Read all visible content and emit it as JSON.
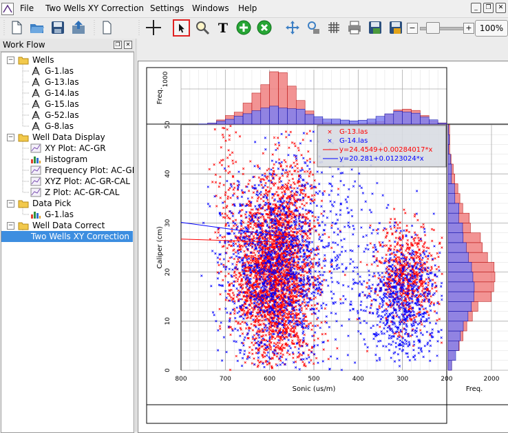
{
  "menubar": {
    "items": [
      "File",
      "Two Wells XY Correction",
      "Settings",
      "Windows",
      "Help"
    ]
  },
  "toolbar": {
    "zoom": "100%"
  },
  "workflow": {
    "title": "Work Flow",
    "tree": [
      {
        "label": "Wells",
        "icon": "folder-icon",
        "level": 0,
        "expander": "−"
      },
      {
        "label": "G-1.las",
        "icon": "well-icon",
        "level": 1
      },
      {
        "label": "G-13.las",
        "icon": "well-icon",
        "level": 1
      },
      {
        "label": "G-14.las",
        "icon": "well-icon",
        "level": 1
      },
      {
        "label": "G-15.las",
        "icon": "well-icon",
        "level": 1
      },
      {
        "label": "G-52.las",
        "icon": "well-icon",
        "level": 1
      },
      {
        "label": "G-8.las",
        "icon": "well-icon",
        "level": 1
      },
      {
        "label": "Well Data Display",
        "icon": "folder-icon",
        "level": 0,
        "expander": "−"
      },
      {
        "label": "XY Plot: AC-GR",
        "icon": "plot-icon",
        "level": 1
      },
      {
        "label": "Histogram",
        "icon": "histogram-icon",
        "level": 1
      },
      {
        "label": "Frequency Plot: AC-GR",
        "icon": "plot-icon",
        "level": 1
      },
      {
        "label": "XYZ Plot: AC-GR-CAL",
        "icon": "plot-icon",
        "level": 1
      },
      {
        "label": "Z Plot: AC-GR-CAL",
        "icon": "plot-icon",
        "level": 1
      },
      {
        "label": "Data Pick",
        "icon": "folder-icon",
        "level": 0,
        "expander": "−"
      },
      {
        "label": "G-1.las",
        "icon": "histogram-icon",
        "level": 1
      },
      {
        "label": "Well Data Correct",
        "icon": "folder-icon",
        "level": 0,
        "expander": "−"
      },
      {
        "label": "Two Wells XY Correction",
        "icon": "none",
        "level": 1,
        "selected": true
      }
    ]
  },
  "chart_data": {
    "type": "scatter",
    "xlabel": "Sonic (us/m)",
    "ylabel": "Caliper (cm)",
    "xlim": [
      800,
      200
    ],
    "ylim": [
      0,
      50
    ],
    "x_ticks": [
      "800",
      "700",
      "600",
      "500",
      "400",
      "300",
      "200"
    ],
    "y_ticks": [
      "0",
      "10",
      "20",
      "30",
      "40",
      "50"
    ],
    "top_hist": {
      "axis_label": "Freq.",
      "tick": "1000"
    },
    "right_hist": {
      "axis_label": "Freq.",
      "tick": "2000"
    },
    "series": [
      {
        "name": "G-13.las",
        "color": "#ff0000",
        "fit": "y=24.4549+0.00284017*x",
        "clusters": [
          {
            "cx": 580,
            "cy": 18,
            "sx": 40,
            "sy": 9,
            "n": 2200
          },
          {
            "cx": 640,
            "cy": 22,
            "sx": 30,
            "sy": 8,
            "n": 400
          },
          {
            "cx": 560,
            "cy": 32,
            "sx": 35,
            "sy": 8,
            "n": 350
          },
          {
            "cx": 290,
            "cy": 19,
            "sx": 35,
            "sy": 5,
            "n": 700
          },
          {
            "cx": 700,
            "cy": 38,
            "sx": 15,
            "sy": 8,
            "n": 90
          }
        ]
      },
      {
        "name": "G-14.las",
        "color": "#0000ff",
        "fit": "y=20.281+0.0123024*x",
        "clusters": [
          {
            "cx": 590,
            "cy": 20,
            "sx": 60,
            "sy": 10,
            "n": 1200
          },
          {
            "cx": 300,
            "cy": 14,
            "sx": 45,
            "sy": 6,
            "n": 700
          },
          {
            "cx": 500,
            "cy": 22,
            "sx": 90,
            "sy": 9,
            "n": 300
          },
          {
            "cx": 450,
            "cy": 33,
            "sx": 100,
            "sy": 7,
            "n": 120
          }
        ]
      }
    ]
  }
}
